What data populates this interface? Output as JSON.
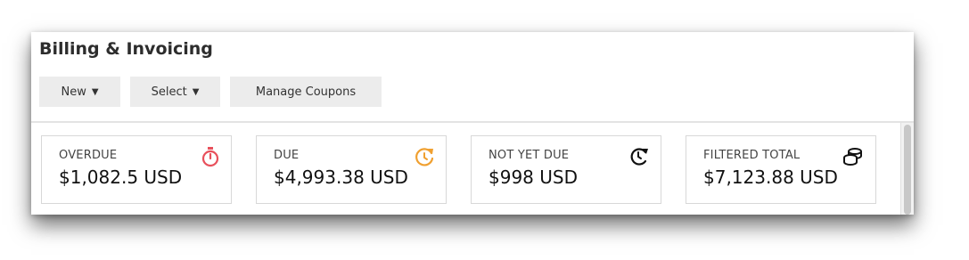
{
  "page": {
    "title": "Billing & Invoicing"
  },
  "toolbar": {
    "new_label": "New",
    "select_label": "Select",
    "coupons_label": "Manage Coupons"
  },
  "cards": [
    {
      "label": "OVERDUE",
      "value": "$1,082.5 USD",
      "icon": "stopwatch-icon",
      "icon_color": "#e8505b"
    },
    {
      "label": "DUE",
      "value": "$4,993.38 USD",
      "icon": "clock-refresh-icon",
      "icon_color": "#f0a030"
    },
    {
      "label": "NOT YET DUE",
      "value": "$998 USD",
      "icon": "clock-forward-icon",
      "icon_color": "#111111"
    },
    {
      "label": "FILTERED TOTAL",
      "value": "$7,123.88 USD",
      "icon": "coins-stack-icon",
      "icon_color": "#111111"
    }
  ]
}
